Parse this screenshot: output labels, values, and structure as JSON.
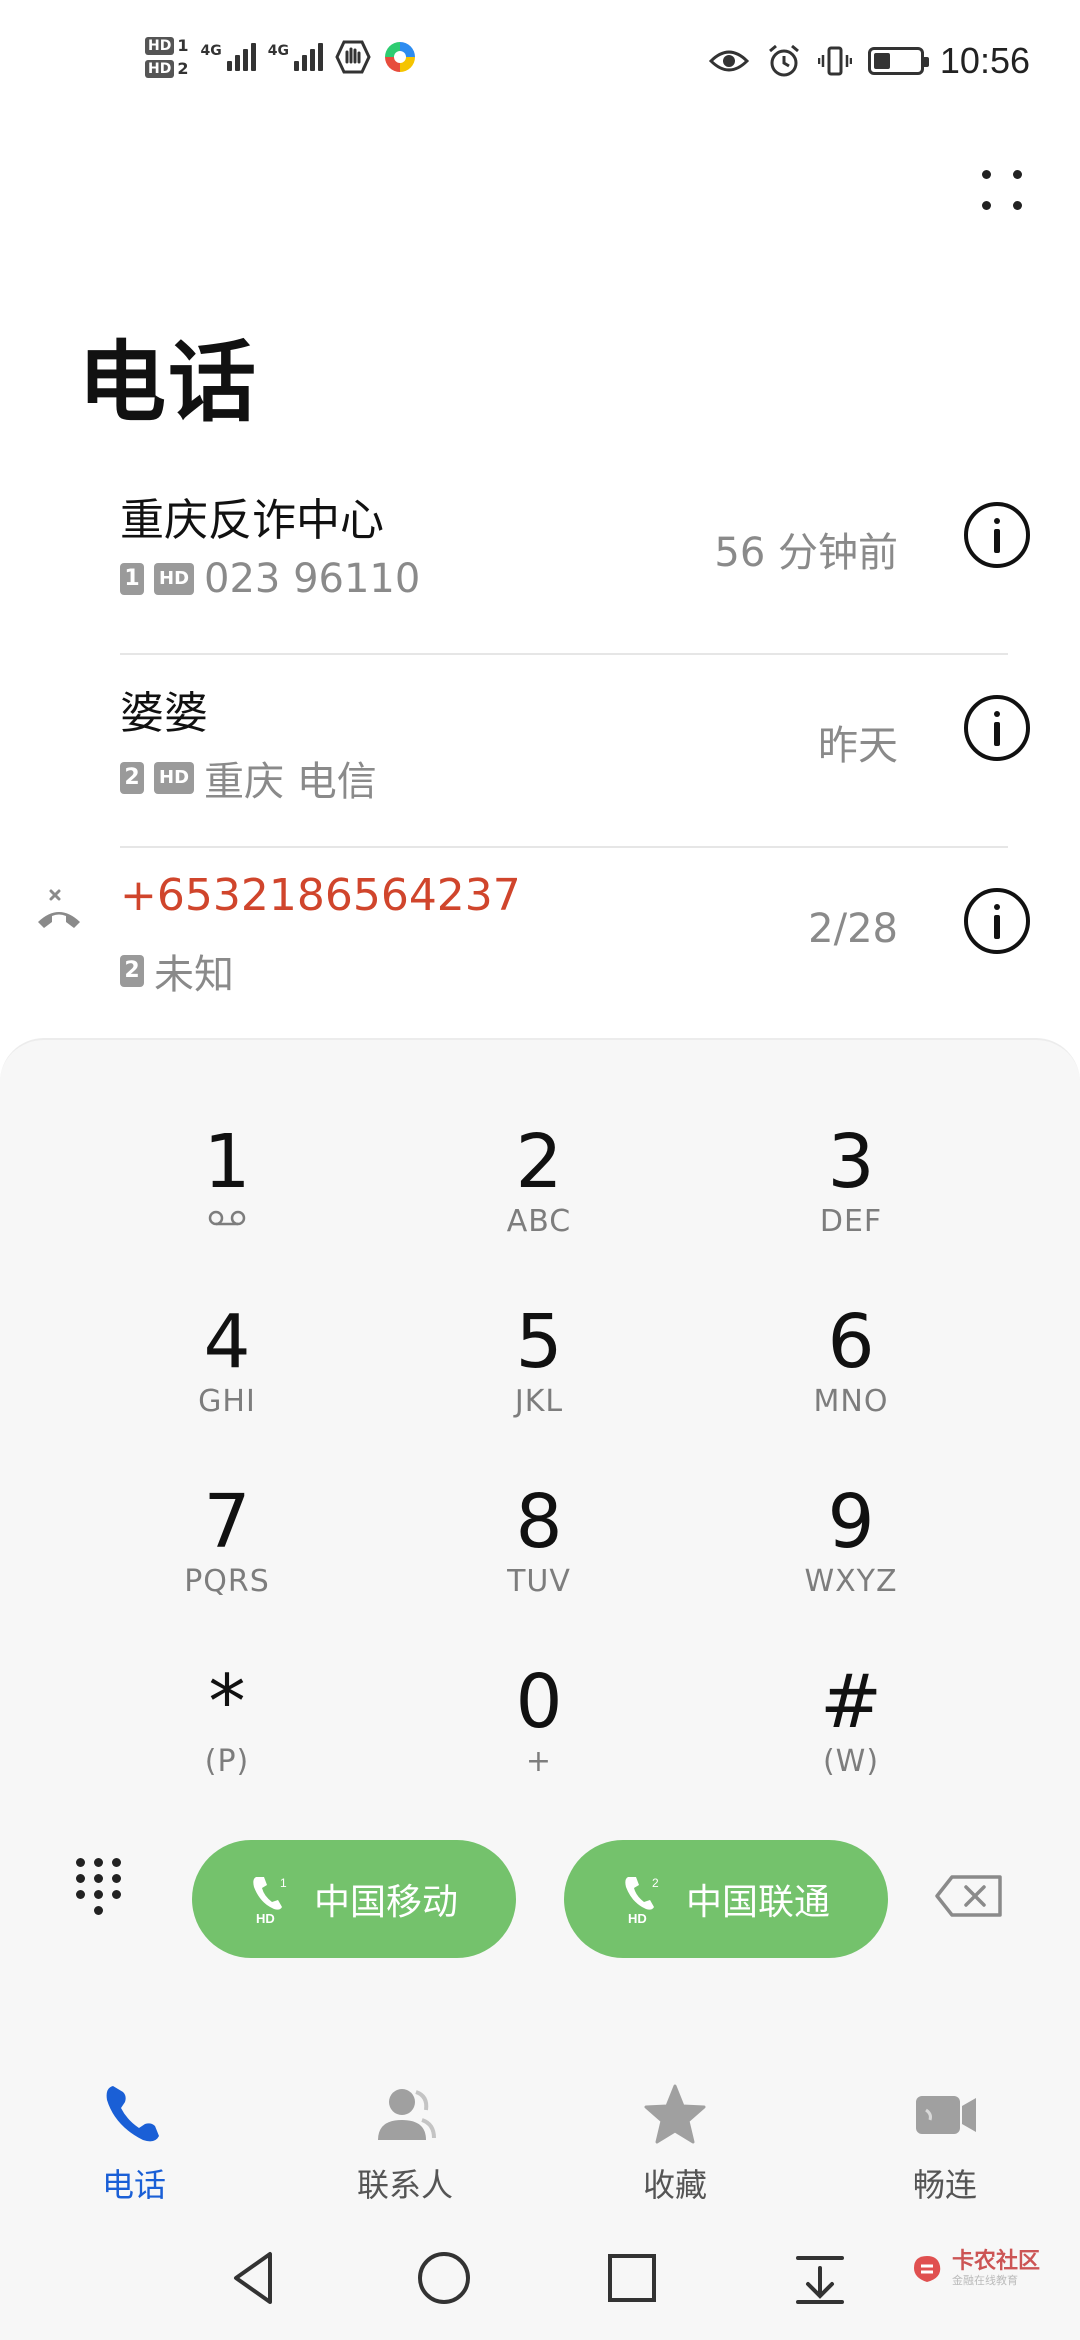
{
  "status_bar": {
    "hd1": "HD",
    "sim1": "1",
    "hd2": "HD",
    "sim2": "2",
    "net1": "4G",
    "net2": "4G",
    "time": "10:56"
  },
  "header": {
    "title": "电话"
  },
  "calls": [
    {
      "name": "重庆反诈中心",
      "sim": "1",
      "hd": "HD",
      "detail": "023 96110",
      "time": "56 分钟前",
      "missed": false
    },
    {
      "name": "婆婆",
      "sim": "2",
      "hd": "HD",
      "detail": "重庆 电信",
      "time": "昨天",
      "missed": false
    },
    {
      "name": "+6532186564237",
      "sim": "2",
      "hd": "",
      "detail": "未知",
      "time": "2/28",
      "missed": true
    }
  ],
  "dialpad": {
    "keys": [
      {
        "digit": "1",
        "letters": ""
      },
      {
        "digit": "2",
        "letters": "ABC"
      },
      {
        "digit": "3",
        "letters": "DEF"
      },
      {
        "digit": "4",
        "letters": "GHI"
      },
      {
        "digit": "5",
        "letters": "JKL"
      },
      {
        "digit": "6",
        "letters": "MNO"
      },
      {
        "digit": "7",
        "letters": "PQRS"
      },
      {
        "digit": "8",
        "letters": "TUV"
      },
      {
        "digit": "9",
        "letters": "WXYZ"
      },
      {
        "digit": "*",
        "letters": "(P)"
      },
      {
        "digit": "0",
        "letters": "+"
      },
      {
        "digit": "#",
        "letters": "(W)"
      }
    ],
    "call_sim1": {
      "label": "中国移动",
      "sim": "1",
      "hd": "HD"
    },
    "call_sim2": {
      "label": "中国联通",
      "sim": "2",
      "hd": "HD"
    }
  },
  "bottom_nav": {
    "tabs": [
      {
        "label": "电话",
        "icon": "phone-icon",
        "active": true
      },
      {
        "label": "联系人",
        "icon": "contacts-icon",
        "active": false
      },
      {
        "label": "收藏",
        "icon": "star-icon",
        "active": false
      },
      {
        "label": "畅连",
        "icon": "video-call-icon",
        "active": false
      }
    ]
  },
  "watermark": {
    "title": "卡农社区",
    "subtitle": "金融在线教育"
  },
  "colors": {
    "accent": "#1a5fd6",
    "missed": "#d0452c",
    "call_button": "#74c26c"
  }
}
